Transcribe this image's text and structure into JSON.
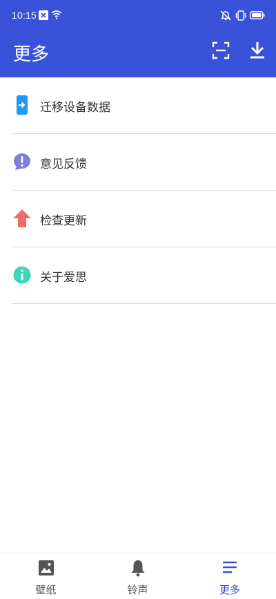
{
  "status_bar": {
    "time": "10:15"
  },
  "header": {
    "title": "更多"
  },
  "menu": {
    "items": [
      {
        "label": "迁移设备数据",
        "icon": "migrate-icon",
        "color": "#1e9af0"
      },
      {
        "label": "意见反馈",
        "icon": "feedback-icon",
        "color": "#7d7de0"
      },
      {
        "label": "检查更新",
        "icon": "update-arrow-icon",
        "color": "#ef6b6b"
      },
      {
        "label": "关于爱思",
        "icon": "info-icon",
        "color": "#3cd6b8"
      }
    ]
  },
  "bottom_nav": {
    "tabs": [
      {
        "label": "壁纸",
        "icon": "image-icon",
        "active": false
      },
      {
        "label": "铃声",
        "icon": "bell-icon",
        "active": false
      },
      {
        "label": "更多",
        "icon": "menu-lines-icon",
        "active": true
      }
    ]
  },
  "colors": {
    "primary": "#3852d9",
    "active_tab": "#3852d9"
  }
}
